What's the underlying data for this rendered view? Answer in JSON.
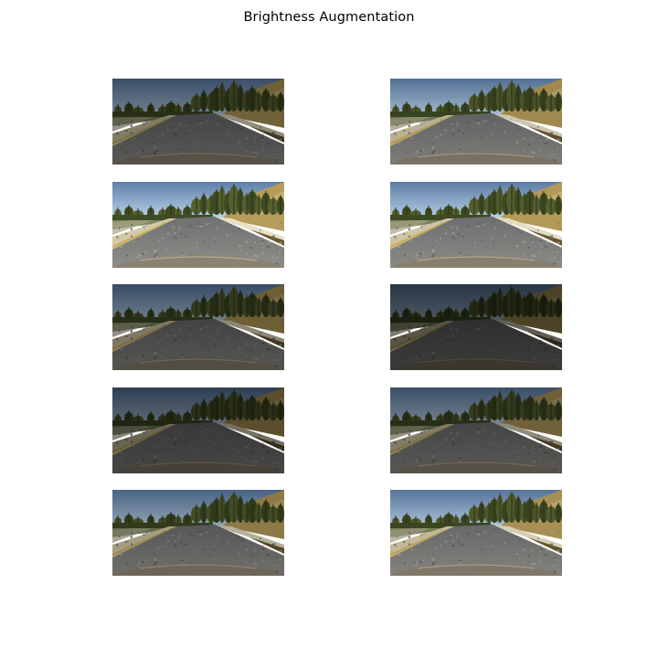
{
  "figure": {
    "title": "Brightness Augmentation"
  },
  "images": [
    {
      "row": 1,
      "col": 1,
      "brightness": 0.62
    },
    {
      "row": 1,
      "col": 2,
      "brightness": 0.88
    },
    {
      "row": 2,
      "col": 1,
      "brightness": 1.0
    },
    {
      "row": 2,
      "col": 2,
      "brightness": 0.98
    },
    {
      "row": 3,
      "col": 1,
      "brightness": 0.6
    },
    {
      "row": 3,
      "col": 2,
      "brightness": 0.42
    },
    {
      "row": 4,
      "col": 1,
      "brightness": 0.5
    },
    {
      "row": 4,
      "col": 2,
      "brightness": 0.62
    },
    {
      "row": 5,
      "col": 1,
      "brightness": 0.78
    },
    {
      "row": 5,
      "col": 2,
      "brightness": 0.92
    }
  ]
}
